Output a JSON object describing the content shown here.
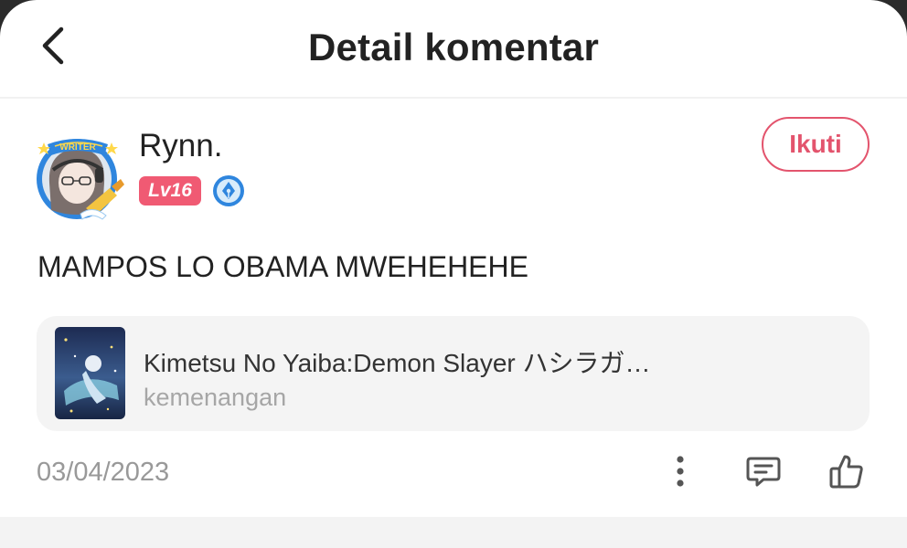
{
  "header": {
    "title": "Detail komentar",
    "back_icon": "chevron-left-icon"
  },
  "user": {
    "name": "Rynn.",
    "level": "Lv16",
    "avatar_frame_label": "WRITER",
    "writer_badge_icon": "pen-nib-icon",
    "follow_label": "Ikuti"
  },
  "comment": {
    "text": "MAMPOS LO OBAMA MWEHEHEHE",
    "date": "03/04/2023"
  },
  "book": {
    "title": "Kimetsu No Yaiba:Demon Slayer ハシラガ…",
    "chapter": "kemenangan"
  },
  "actions": {
    "more_icon": "more-vertical-icon",
    "reply_icon": "comment-icon",
    "like_icon": "thumbs-up-icon"
  },
  "colors": {
    "accent": "#e3546d",
    "level_badge": "#f05a73",
    "writer_badge": "#2f86de",
    "card_bg": "#f4f4f4"
  }
}
